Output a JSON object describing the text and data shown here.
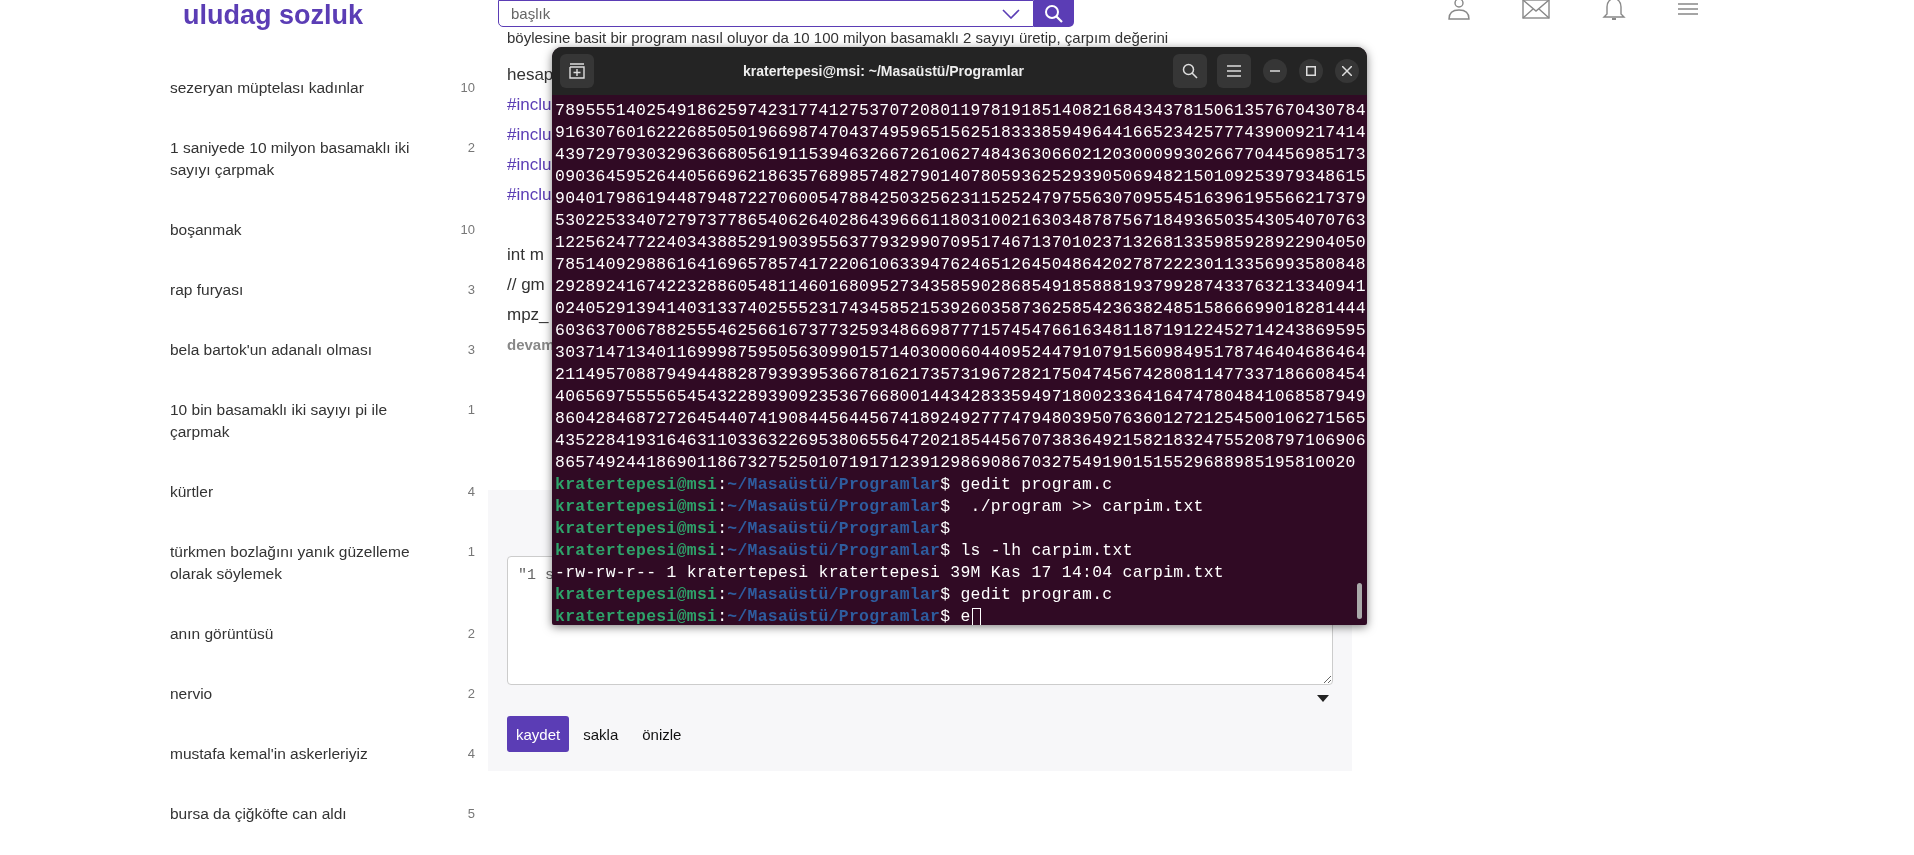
{
  "header": {
    "logo": "uludag sozluk",
    "search": {
      "placeholder": "başlık"
    }
  },
  "sidebar": {
    "items": [
      {
        "title": "sezeryan müptelası kadınlar",
        "count": "10"
      },
      {
        "title": "1 saniyede 10 milyon basamaklı iki sayıyı çarpmak",
        "count": "2"
      },
      {
        "title": "boşanmak",
        "count": "10"
      },
      {
        "title": "rap furyası",
        "count": "3"
      },
      {
        "title": "bela bartok'un adanalı olması",
        "count": "3"
      },
      {
        "title": "10 bin basamaklı iki sayıyı pi ile çarpmak",
        "count": "1"
      },
      {
        "title": "kürtler",
        "count": "4"
      },
      {
        "title": "türkmen bozlağını yanık güzelleme olarak söylemek",
        "count": "1"
      },
      {
        "title": "anın görüntüsü",
        "count": "2"
      },
      {
        "title": "nervio",
        "count": "2"
      },
      {
        "title": "mustafa kemal'in askerleriyiz",
        "count": "4"
      },
      {
        "title": "bursa da çiğköfte can aldı",
        "count": "5"
      }
    ]
  },
  "entry": {
    "lines": [
      {
        "kind": "text",
        "text": "böylesine basit bir program nasıl oluyor da 10 100 milyon basamaklı 2 sayıyı üretip, çarpım değerini"
      },
      {
        "kind": "text",
        "text": "hesap"
      },
      {
        "kind": "code",
        "text": "#inclu"
      },
      {
        "kind": "code",
        "text": "#inclu"
      },
      {
        "kind": "code",
        "text": "#inclu"
      },
      {
        "kind": "code",
        "text": "#inclu"
      },
      {
        "kind": "blank"
      },
      {
        "kind": "text",
        "text": "int m"
      },
      {
        "kind": "text",
        "text": "// gm"
      },
      {
        "kind": "text",
        "text": "mpz_"
      },
      {
        "kind": "more",
        "text": "devam"
      }
    ]
  },
  "editor": {
    "value": "\"1 s",
    "buttons": [
      {
        "label": "kaydet",
        "kind": "primary"
      },
      {
        "label": "sakla",
        "kind": "plain"
      },
      {
        "label": "önizle",
        "kind": "plain"
      }
    ]
  },
  "terminal": {
    "title": "kratertepesi@msi: ~/Masaüstü/Programlar",
    "lines": [
      {
        "kind": "output",
        "text": "78955514025491862597423177412753707208011978191851408216843437815061357670430784"
      },
      {
        "kind": "output",
        "text": "91630760162226850501966987470437495965156251833385949644166523425777439009217414"
      },
      {
        "kind": "output",
        "text": "43972979303296366805619115394632667261062748436306602120300099302667704456985173"
      },
      {
        "kind": "output",
        "text": "09036459526440566962186357689857482790140780593625293905069482150109253979348615"
      },
      {
        "kind": "output",
        "text": "90401798619448794872270600547884250325623115252479755630709554516396195566217379"
      },
      {
        "kind": "output",
        "text": "53022533407279737786540626402864396661180310021630348787567184936503543054070763"
      },
      {
        "kind": "output",
        "text": "12256247722403438852919039556377932990709517467137010237132681335985928922904050"
      },
      {
        "kind": "output",
        "text": "78514092988616416965785741722061063394762465126450486420278722230113356993580848"
      },
      {
        "kind": "output",
        "text": "29289241674223288605481146016809527343585902868549185888193799287433763213340941"
      },
      {
        "kind": "output",
        "text": "02405291394140313374025552317434585215392603587362585423638248515866699018281444"
      },
      {
        "kind": "output",
        "text": "60363700678825554625661673773259348669877715745476616348118719122452714243869595"
      },
      {
        "kind": "output",
        "text": "30371471340116999875950563099015714030006044095244791079156098495178746404686464"
      },
      {
        "kind": "output",
        "text": "21149570887949448828793939536678162173573196728217504745674280811477337186608454"
      },
      {
        "kind": "output",
        "text": "40656975555654543228939092353676680014434283359497180023364164747804841068587949"
      },
      {
        "kind": "output",
        "text": "86042846872726454407419084456445674189249277747948039507636012721254500106271565"
      },
      {
        "kind": "output",
        "text": "43522841931646311033632269538065564720218544567073836492158218324755208797106906"
      },
      {
        "kind": "output",
        "text": "8657492441869011867327525010719171239129869086703275491901515529688985195810020"
      },
      {
        "kind": "prompt",
        "user": "kratertepesi@msi",
        "separator": ":",
        "path": "~/Masaüstü/Programlar",
        "command": "$ gedit program.c",
        "cursor": false
      },
      {
        "kind": "prompt",
        "user": "kratertepesi@msi",
        "separator": ":",
        "path": "~/Masaüstü/Programlar",
        "command": "$  ./program >> carpim.txt",
        "cursor": false
      },
      {
        "kind": "prompt",
        "user": "kratertepesi@msi",
        "separator": ":",
        "path": "~/Masaüstü/Programlar",
        "command": "$",
        "cursor": false
      },
      {
        "kind": "prompt",
        "user": "kratertepesi@msi",
        "separator": ":",
        "path": "~/Masaüstü/Programlar",
        "command": "$ ls -lh carpim.txt",
        "cursor": false
      },
      {
        "kind": "output",
        "text": "-rw-rw-r-- 1 kratertepesi kratertepesi 39M Kas 17 14:04 carpim.txt"
      },
      {
        "kind": "prompt",
        "user": "kratertepesi@msi",
        "separator": ":",
        "path": "~/Masaüstü/Programlar",
        "command": "$ gedit program.c",
        "cursor": false
      },
      {
        "kind": "prompt",
        "user": "kratertepesi@msi",
        "separator": ":",
        "path": "~/Masaüstü/Programlar",
        "command": "$ e",
        "cursor": true
      }
    ]
  }
}
